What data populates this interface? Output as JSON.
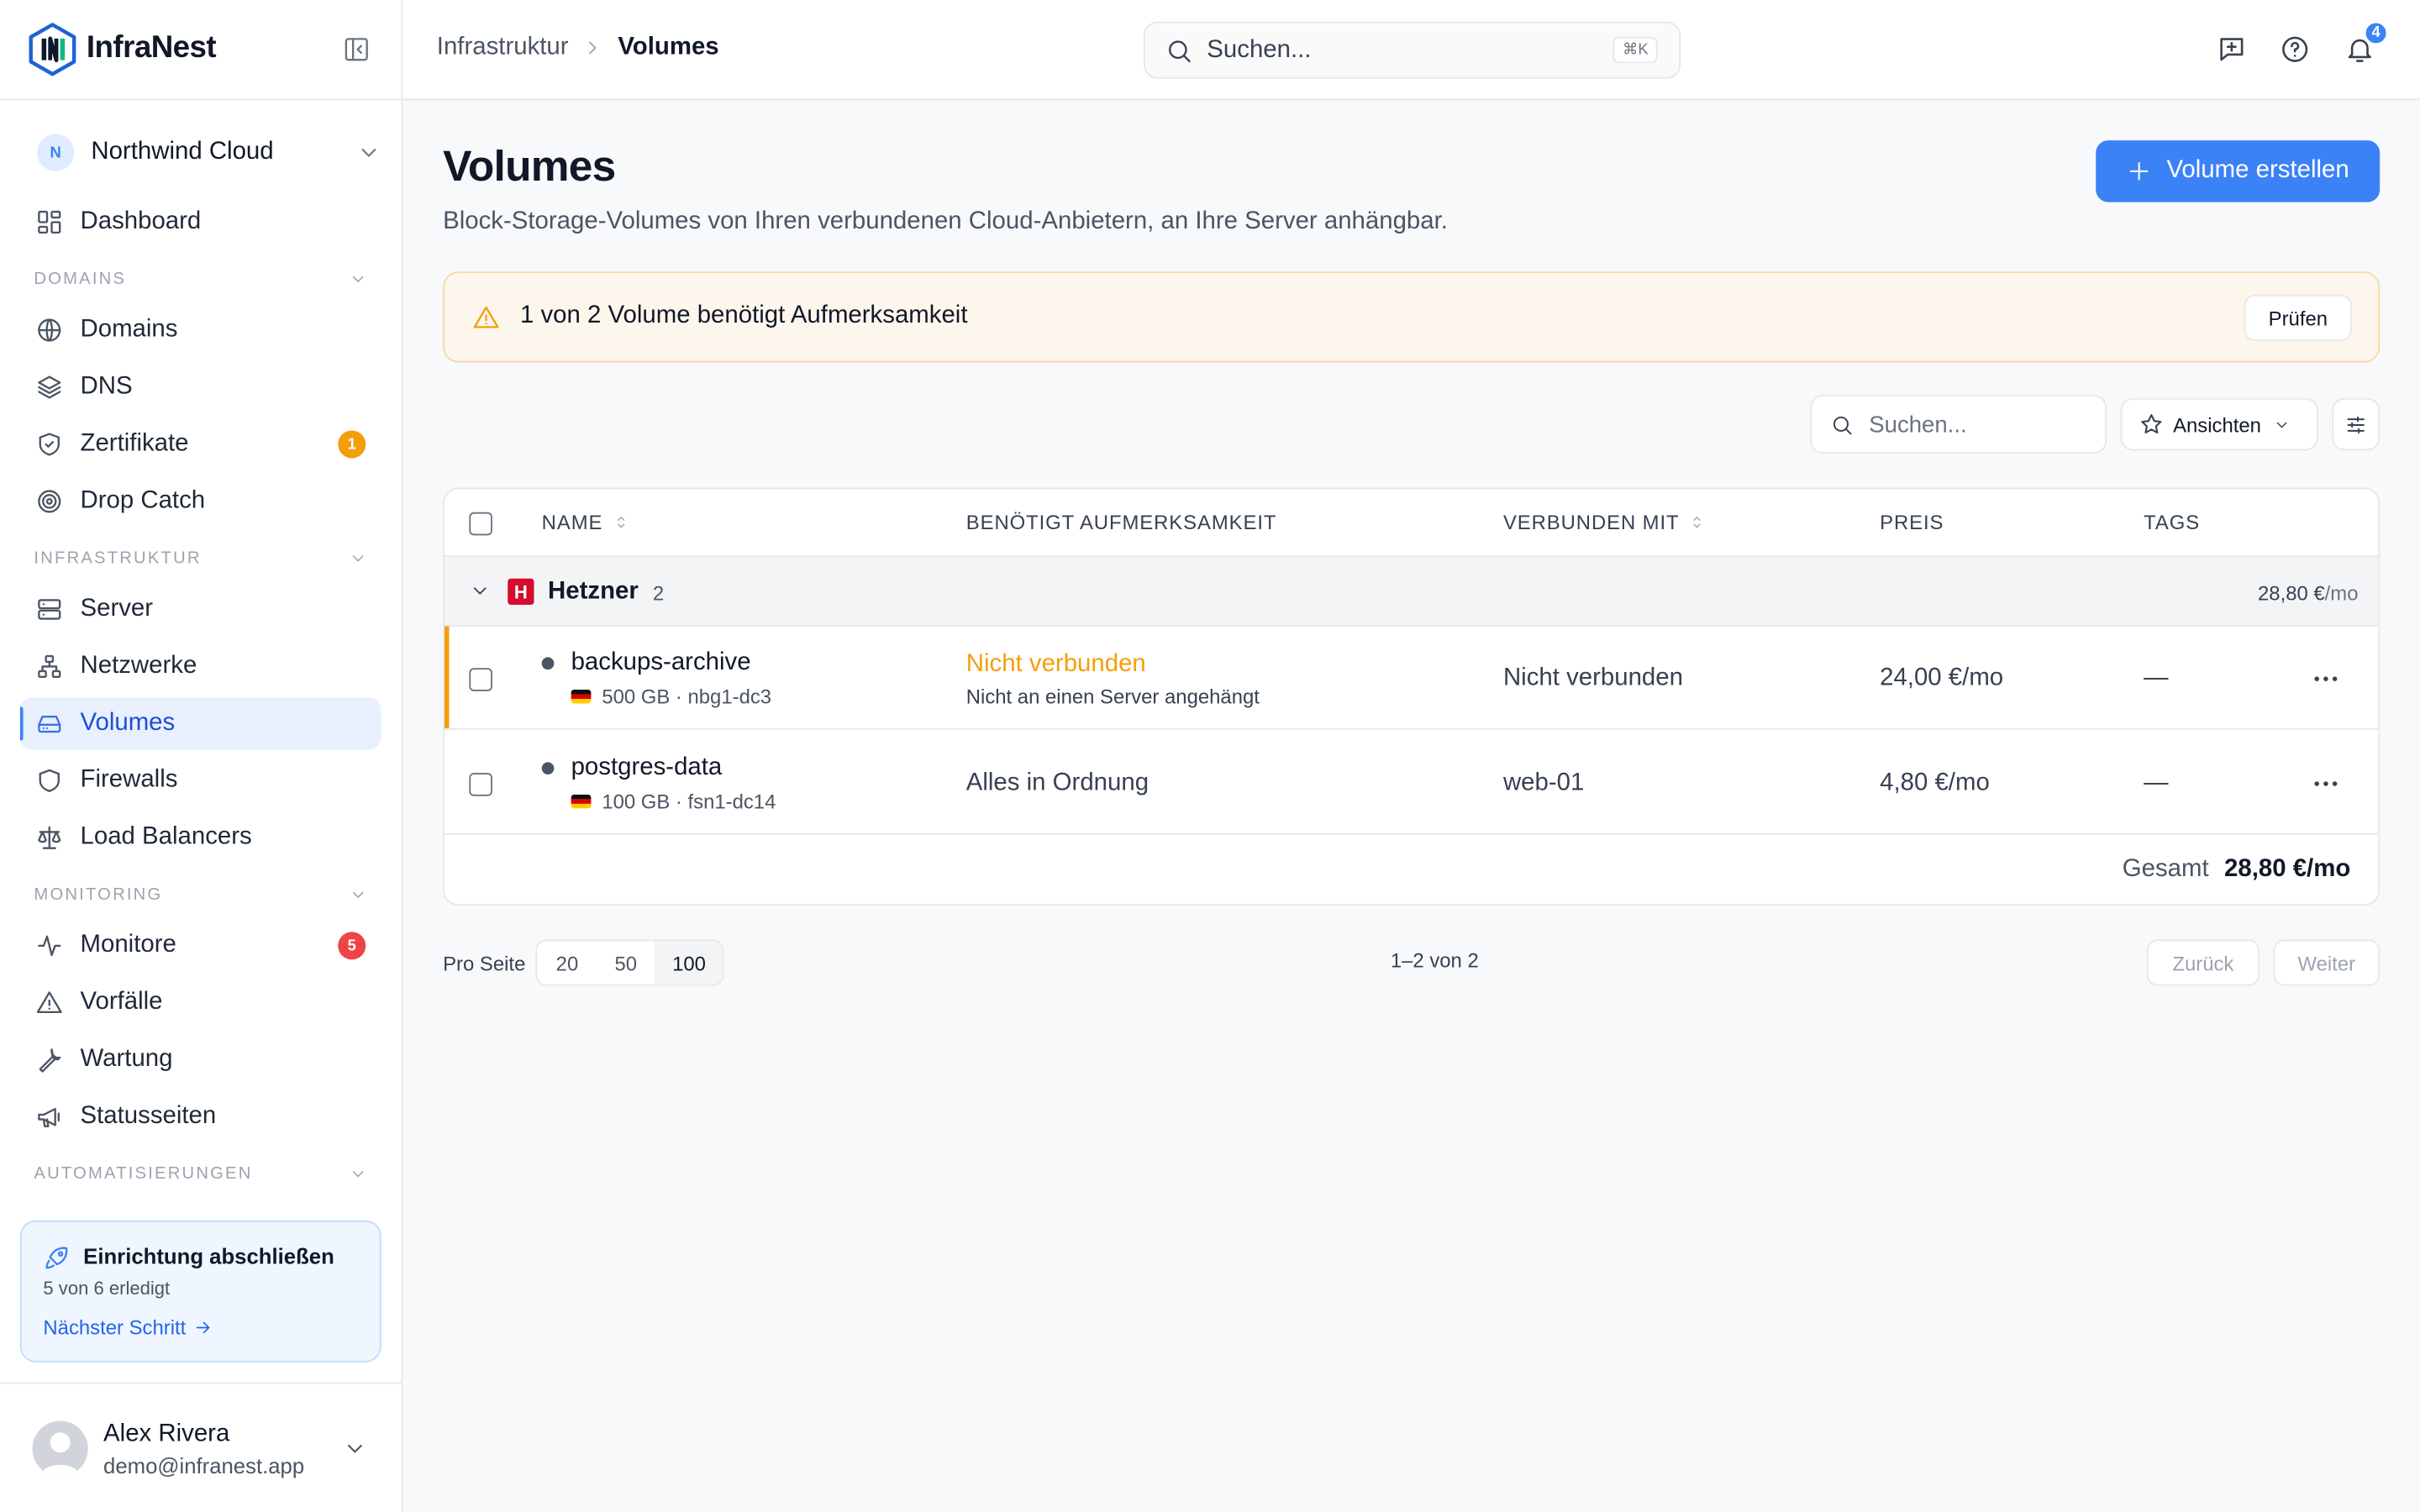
{
  "app": {
    "name": "InfraNest"
  },
  "org": {
    "initial": "N",
    "name": "Northwind Cloud"
  },
  "nav": {
    "dashboard": "Dashboard",
    "sections": {
      "domains": "DOMAINS",
      "infra": "INFRASTRUKTUR",
      "monitoring": "MONITORING",
      "automation": "AUTOMATISIERUNGEN"
    },
    "items": {
      "domains": "Domains",
      "dns": "DNS",
      "certs": "Zertifikate",
      "dropcatch": "Drop Catch",
      "server": "Server",
      "networks": "Netzwerke",
      "volumes": "Volumes",
      "firewalls": "Firewalls",
      "lb": "Load Balancers",
      "monitors": "Monitore",
      "incidents": "Vorfälle",
      "maintenance": "Wartung",
      "statuspages": "Statusseiten"
    },
    "badges": {
      "certs": "1",
      "monitors": "5"
    },
    "badge_colors": {
      "certs": "#f59e0b",
      "monitors": "#ef4444"
    }
  },
  "setup": {
    "title": "Einrichtung abschließen",
    "progress": "5 von 6 erledigt",
    "link": "Nächster Schritt"
  },
  "user": {
    "name": "Alex Rivera",
    "email": "demo@infranest.app"
  },
  "header": {
    "breadcrumb": [
      "Infrastruktur",
      "Volumes"
    ],
    "search_placeholder": "Suchen...",
    "shortcut": "⌘K",
    "notifications": "4"
  },
  "page": {
    "title": "Volumes",
    "subtitle": "Block-Storage-Volumes von Ihren verbundenen Cloud-Anbietern, an Ihre Server anhängbar.",
    "create_button": "Volume erstellen"
  },
  "alert": {
    "text": "1 von 2 Volume benötigt Aufmerksamkeit",
    "button": "Prüfen"
  },
  "toolbar": {
    "search_placeholder": "Suchen...",
    "views": "Ansichten"
  },
  "table": {
    "columns": {
      "name": "NAME",
      "attention": "BENÖTIGT AUFMERKSAMKEIT",
      "connected": "VERBUNDEN MIT",
      "price": "PREIS",
      "tags": "TAGS"
    },
    "group": {
      "logo": "H",
      "name": "Hetzner",
      "count": "2",
      "total": "28,80 €",
      "total_unit": "/mo"
    },
    "rows": [
      {
        "name": "backups-archive",
        "meta": "500 GB · nbg1-dc3",
        "status": "Nicht verbunden",
        "status_detail": "Nicht an einen Server angehängt",
        "connected": "Nicht verbunden",
        "price": "24,00 €/mo",
        "tags": "—",
        "status_color": "#f59e0b"
      },
      {
        "name": "postgres-data",
        "meta": "100 GB · fsn1-dc14",
        "status": "Alles in Ordnung",
        "connected": "web-01",
        "price": "4,80 €/mo",
        "tags": "—"
      }
    ],
    "total_label": "Gesamt",
    "total_value": "28,80 €/mo"
  },
  "pagination": {
    "per_page_label": "Pro Seite",
    "sizes": [
      "20",
      "50",
      "100"
    ],
    "selected": "100",
    "range": "1–2 von 2",
    "prev": "Zurück",
    "next": "Weiter"
  }
}
